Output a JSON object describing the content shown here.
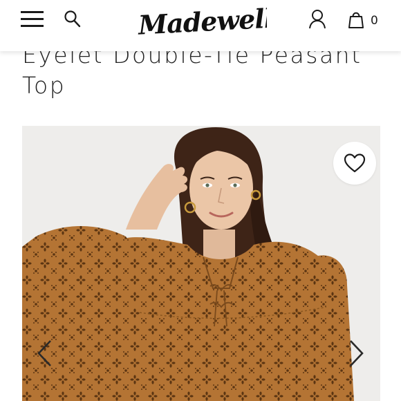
{
  "header": {
    "brand": "Madewell",
    "bag_count": "0",
    "icons": {
      "menu": "hamburger-menu-icon",
      "search": "search-icon",
      "account": "user-icon",
      "bag": "shopping-bag-icon"
    }
  },
  "product": {
    "title_line1": "Eyelet Double-Tie Peasant",
    "title_line2": "Top",
    "color": "#b5752f"
  },
  "gallery": {
    "favorite_icon": "heart-icon",
    "prev_icon": "chevron-left-icon",
    "next_icon": "chevron-right-icon"
  }
}
